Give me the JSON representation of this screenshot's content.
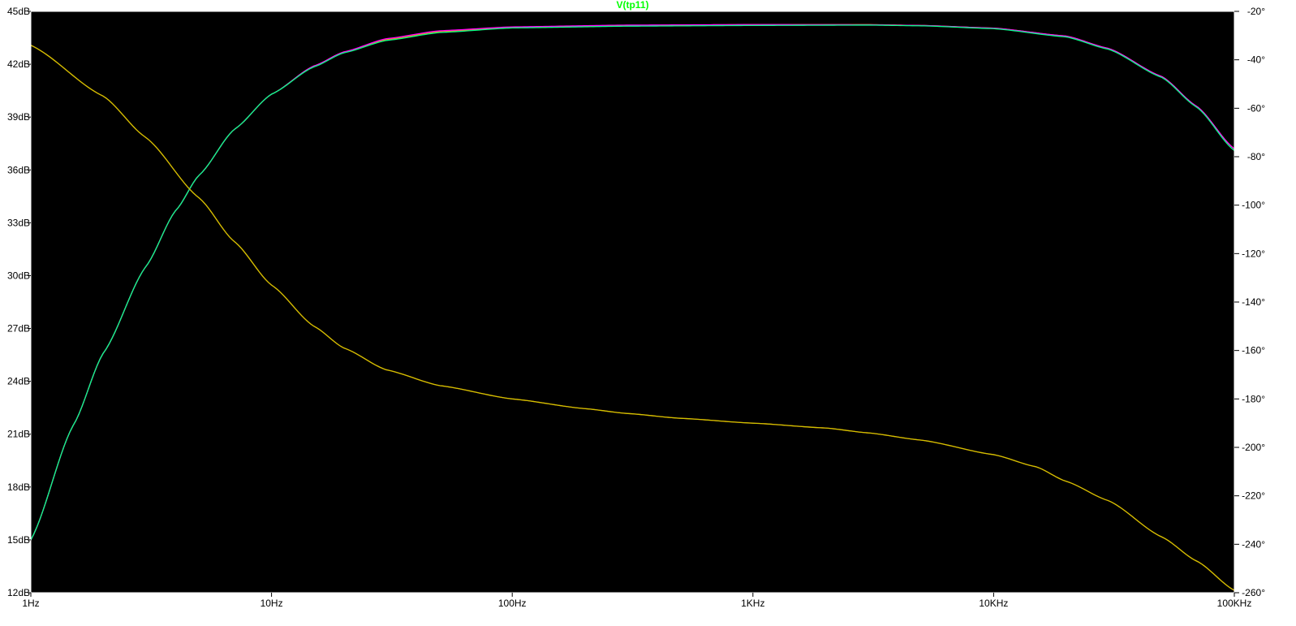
{
  "chart_data": {
    "type": "line",
    "title": "V(tp11)",
    "title_color": "#00ff00",
    "background": "#000000",
    "axis_color": "#ffffff",
    "x_axis": {
      "scale": "log",
      "range_hz": [
        1,
        100000
      ],
      "ticks": [
        {
          "value": 1,
          "label": "1Hz"
        },
        {
          "value": 10,
          "label": "10Hz"
        },
        {
          "value": 100,
          "label": "100Hz"
        },
        {
          "value": 1000,
          "label": "1KHz"
        },
        {
          "value": 10000,
          "label": "10KHz"
        },
        {
          "value": 100000,
          "label": "100KHz"
        }
      ]
    },
    "y_left": {
      "unit": "dB",
      "range": [
        12,
        45
      ],
      "ticks": [
        {
          "value": 45,
          "label": "45dB"
        },
        {
          "value": 42,
          "label": "42dB"
        },
        {
          "value": 39,
          "label": "39dB"
        },
        {
          "value": 36,
          "label": "36dB"
        },
        {
          "value": 33,
          "label": "33dB"
        },
        {
          "value": 30,
          "label": "30dB"
        },
        {
          "value": 27,
          "label": "27dB"
        },
        {
          "value": 24,
          "label": "24dB"
        },
        {
          "value": 21,
          "label": "21dB"
        },
        {
          "value": 18,
          "label": "18dB"
        },
        {
          "value": 15,
          "label": "15dB"
        },
        {
          "value": 12,
          "label": "12dB"
        }
      ]
    },
    "y_right": {
      "unit": "deg",
      "range": [
        -260,
        -20
      ],
      "ticks": [
        {
          "value": -20,
          "label": "-20°"
        },
        {
          "value": -40,
          "label": "-40°"
        },
        {
          "value": -60,
          "label": "-60°"
        },
        {
          "value": -80,
          "label": "-80°"
        },
        {
          "value": -100,
          "label": "-100°"
        },
        {
          "value": -120,
          "label": "-120°"
        },
        {
          "value": -140,
          "label": "-140°"
        },
        {
          "value": -160,
          "label": "-160°"
        },
        {
          "value": -180,
          "label": "-180°"
        },
        {
          "value": -200,
          "label": "-200°"
        },
        {
          "value": -220,
          "label": "-220°"
        },
        {
          "value": -240,
          "label": "-240°"
        },
        {
          "value": -260,
          "label": "-260°"
        }
      ]
    },
    "series": [
      {
        "kind": "magnitude",
        "axis": "left",
        "color": "#ff8c00",
        "points": [
          [
            1,
            15.0
          ],
          [
            1.5,
            21.5
          ],
          [
            2,
            25.6
          ],
          [
            3,
            30.5
          ],
          [
            4,
            33.7
          ],
          [
            5,
            35.7
          ],
          [
            7,
            38.3
          ],
          [
            10,
            40.3
          ],
          [
            15,
            41.9
          ],
          [
            20,
            42.7
          ],
          [
            30,
            43.4
          ],
          [
            50,
            43.85
          ],
          [
            100,
            44.1
          ],
          [
            300,
            44.2
          ],
          [
            1000,
            44.25
          ],
          [
            3000,
            44.25
          ],
          [
            5000,
            44.2
          ],
          [
            10000,
            44.05
          ],
          [
            20000,
            43.6
          ],
          [
            30000,
            42.9
          ],
          [
            50000,
            41.3
          ],
          [
            70000,
            39.6
          ],
          [
            100000,
            37.2
          ]
        ]
      },
      {
        "kind": "magnitude",
        "axis": "left",
        "color": "#ff00ff",
        "points": [
          [
            1,
            15.0
          ],
          [
            1.5,
            21.5
          ],
          [
            2,
            25.6
          ],
          [
            3,
            30.5
          ],
          [
            4,
            33.7
          ],
          [
            5,
            35.7
          ],
          [
            7,
            38.3
          ],
          [
            10,
            40.3
          ],
          [
            15,
            41.9
          ],
          [
            20,
            42.7
          ],
          [
            30,
            43.45
          ],
          [
            50,
            43.9
          ],
          [
            100,
            44.12
          ],
          [
            300,
            44.22
          ],
          [
            1000,
            44.25
          ],
          [
            3000,
            44.24
          ],
          [
            5000,
            44.2
          ],
          [
            10000,
            44.05
          ],
          [
            20000,
            43.6
          ],
          [
            30000,
            42.9
          ],
          [
            50000,
            41.3
          ],
          [
            70000,
            39.6
          ],
          [
            100000,
            37.2
          ]
        ]
      },
      {
        "kind": "magnitude",
        "axis": "left",
        "color": "#00ff88",
        "points": [
          [
            1,
            15.0
          ],
          [
            1.5,
            21.5
          ],
          [
            2,
            25.6
          ],
          [
            3,
            30.5
          ],
          [
            4,
            33.7
          ],
          [
            5,
            35.7
          ],
          [
            7,
            38.3
          ],
          [
            10,
            40.3
          ],
          [
            15,
            41.85
          ],
          [
            20,
            42.65
          ],
          [
            30,
            43.35
          ],
          [
            50,
            43.8
          ],
          [
            100,
            44.06
          ],
          [
            300,
            44.16
          ],
          [
            1000,
            44.2
          ],
          [
            3000,
            44.22
          ],
          [
            5000,
            44.18
          ],
          [
            10000,
            44.02
          ],
          [
            20000,
            43.55
          ],
          [
            30000,
            42.85
          ],
          [
            50000,
            41.25
          ],
          [
            70000,
            39.55
          ],
          [
            100000,
            37.1
          ]
        ]
      },
      {
        "kind": "phase",
        "axis": "right",
        "color": "#ff0000",
        "points": [
          [
            1,
            -34
          ],
          [
            2,
            -55
          ],
          [
            3,
            -72
          ],
          [
            5,
            -97
          ],
          [
            7,
            -115
          ],
          [
            10,
            -133
          ],
          [
            15,
            -150
          ],
          [
            20,
            -159
          ],
          [
            30,
            -168
          ],
          [
            50,
            -174.5
          ],
          [
            100,
            -180
          ],
          [
            200,
            -184
          ],
          [
            300,
            -186
          ],
          [
            500,
            -188
          ],
          [
            1000,
            -190
          ],
          [
            2000,
            -192
          ],
          [
            3000,
            -194
          ],
          [
            5000,
            -197
          ],
          [
            10000,
            -203
          ],
          [
            15000,
            -208
          ],
          [
            20000,
            -214
          ],
          [
            30000,
            -222
          ],
          [
            50000,
            -237
          ],
          [
            70000,
            -247
          ],
          [
            100000,
            -259
          ]
        ]
      },
      {
        "kind": "phase",
        "axis": "right",
        "color": "#c8c800",
        "points": [
          [
            1,
            -34
          ],
          [
            2,
            -55
          ],
          [
            3,
            -72
          ],
          [
            5,
            -97
          ],
          [
            7,
            -115
          ],
          [
            10,
            -133
          ],
          [
            15,
            -150
          ],
          [
            20,
            -159
          ],
          [
            30,
            -168
          ],
          [
            50,
            -174.5
          ],
          [
            100,
            -180
          ],
          [
            200,
            -184
          ],
          [
            300,
            -186
          ],
          [
            500,
            -188
          ],
          [
            1000,
            -190
          ],
          [
            2000,
            -192
          ],
          [
            3000,
            -194
          ],
          [
            5000,
            -197
          ],
          [
            10000,
            -203
          ],
          [
            15000,
            -208
          ],
          [
            20000,
            -214
          ],
          [
            30000,
            -222
          ],
          [
            50000,
            -237
          ],
          [
            70000,
            -247
          ],
          [
            100000,
            -259
          ]
        ]
      }
    ]
  }
}
